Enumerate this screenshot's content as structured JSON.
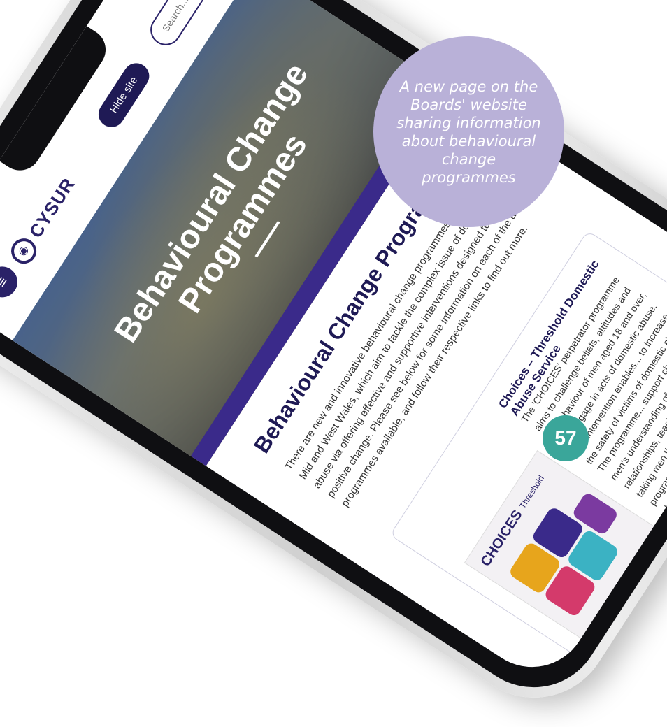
{
  "site": {
    "logo_text": "CYSUR",
    "hide_site_label": "Hide site",
    "search_placeholder": "Search..."
  },
  "hero": {
    "title": "Behavioural Change Programmes"
  },
  "content": {
    "heading": "Behavioural Change Programmes",
    "intro": "There are new and innovative behavioural change programmes underway in Mid and West Wales, which aim to tackle the complex issue of domestic abuse via offering effective and supportive interventions designed to promote positive change. Please see below for some information on each of the two programmes available, and follow their respective links to find out more."
  },
  "card": {
    "title": "Choices – Threshold Domestic Abuse Service",
    "text1": "The 'CHOICES' perpetrator programme aims to challenge beliefs, attitudes and the behaviour of men aged 18 and over, who engage in acts of domestic abuse. This intervention enables... to increase the safety of victims of domestic abuse...",
    "text2": "The programme... support change and men's understanding of abuse and relationships, teaching non-abusive, and taking men through a structured programme, which step by step... change.",
    "image_logo": "CHOICES",
    "image_sublogo": "Threshold"
  },
  "callout": {
    "text": "A new page on the Boards' website sharing information about behavioural change programmes"
  },
  "page_number": "57",
  "colors": {
    "brand_navy": "#2a2268",
    "callout_lilac": "#b9b1d8",
    "badge_teal": "#3aa69a"
  }
}
